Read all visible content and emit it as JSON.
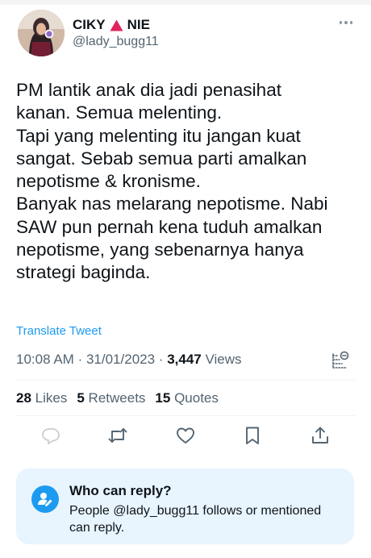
{
  "author": {
    "name_part1": "CIKY",
    "name_part2": "NIE",
    "handle": "@lady_bugg11"
  },
  "tweet": {
    "lines": [
      "PM lantik anak dia jadi penasihat",
      "kanan. Semua melenting.",
      "Tapi yang melenting itu jangan kuat",
      "sangat. Sebab semua parti amalkan",
      "nepotisme & kronisme.",
      "Banyak nas melarang nepotisme. Nabi",
      "SAW pun pernah kena tuduh amalkan",
      "nepotisme, yang sebenarnya hanya",
      "strategi baginda."
    ],
    "translate_label": "Translate Tweet",
    "time": "10:08 AM",
    "separator": "·",
    "date": "31/01/2023",
    "views_count": "3,447",
    "views_label": "Views"
  },
  "stats": {
    "likes_count": "28",
    "likes_label": "Likes",
    "retweets_count": "5",
    "retweets_label": "Retweets",
    "quotes_count": "15",
    "quotes_label": "Quotes"
  },
  "actions": [
    "reply-icon",
    "retweet-icon",
    "like-icon",
    "bookmark-icon",
    "share-icon"
  ],
  "reply_settings": {
    "title": "Who can reply?",
    "description": "People @lady_bugg11 follows or mentioned can reply."
  },
  "colors": {
    "accent": "#1d9bf0",
    "secondary_text": "#536471",
    "primary_text": "#0f1419",
    "warning_triangle": "#e0245e",
    "reply_box_bg": "#e8f4fe"
  }
}
